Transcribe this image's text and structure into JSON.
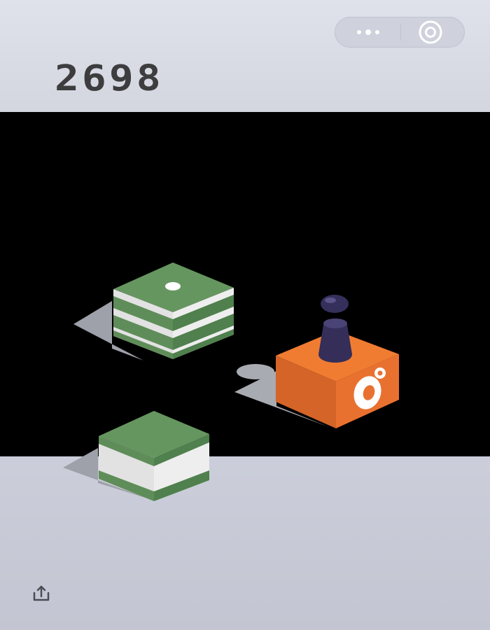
{
  "game": {
    "score": "2698"
  },
  "capsule": {
    "more_icon": "more-dots-icon",
    "close_icon": "target-ring-icon"
  },
  "share": {
    "icon": "share-upload-icon"
  },
  "colors": {
    "green_top": "#66965f",
    "green_side": "#4d7e4b",
    "white_band": "#eeeeee",
    "orange_top": "#f07c32",
    "orange_side": "#cf5e24",
    "piece": "#342e59",
    "score_text": "#3d3d3f",
    "playfield": "#000000"
  }
}
